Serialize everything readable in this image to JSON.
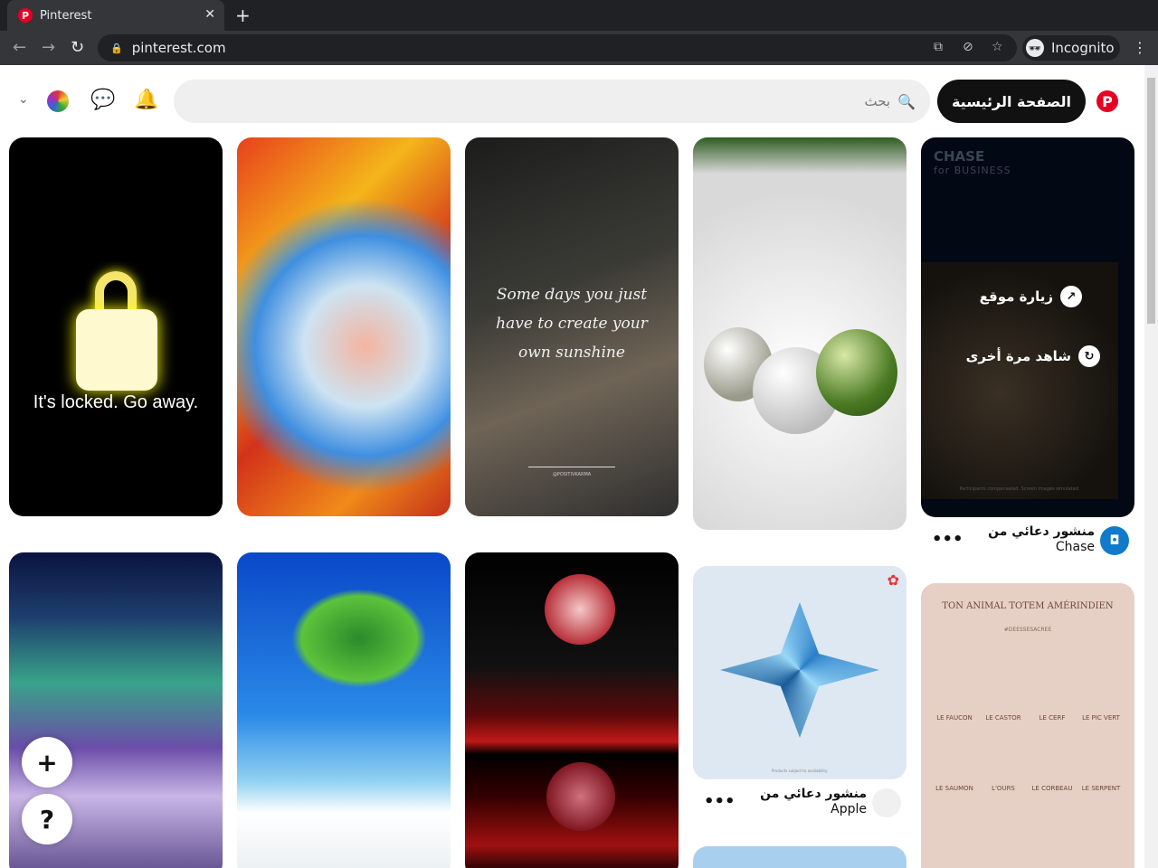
{
  "browser": {
    "tab_title": "Pinterest",
    "url": "pinterest.com",
    "profile": "Incognito"
  },
  "header": {
    "home_label": "الصفحة الرئيسية",
    "search_placeholder": "بحث"
  },
  "pins": {
    "locked_text": "It's locked. Go away.",
    "sunshine_text": "Some days you just have to create your own sunshine",
    "sunshine_handle": "@POSITIVKARMA",
    "chase_brand": "CHASE",
    "chase_sub": "for BUSINESS",
    "chase_disclaimer": "Participants compensated. Screen images simulated.",
    "visit_site": "زيارة موقع",
    "watch_again": "شاهد مرة أخرى",
    "apple_disclaimer": "Products subject to availability.",
    "totem_title": "TON ANIMAL TOTEM AMÉRINDIEN",
    "totem_tag": "#DEESSESACREE",
    "totem_animals": [
      "LE FAUCON",
      "LE CASTOR",
      "LE CERF",
      "LE PIC VERT",
      "LE SAUMON",
      "L'OURS",
      "LE CORBEAU",
      "LE SERPENT"
    ]
  },
  "promoted": [
    {
      "label": "منشور دعائي من",
      "brand": "Chase",
      "color": "#117aca"
    },
    {
      "label": "منشور دعائي من",
      "brand": "Apple",
      "color": "#111111"
    }
  ],
  "fab": {
    "add": "+",
    "help": "?"
  }
}
